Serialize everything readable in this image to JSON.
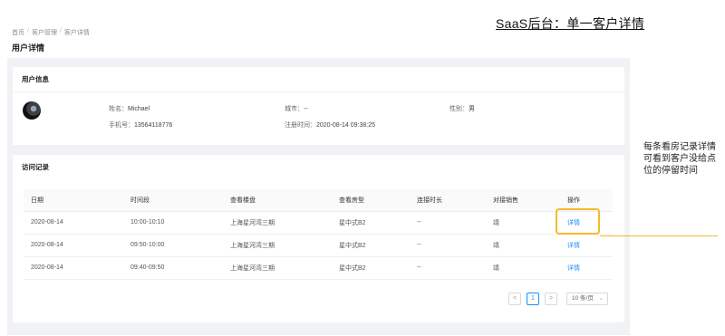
{
  "slide_title": "SaaS后台：单一客户详情",
  "breadcrumb": [
    "首页",
    "客户管理",
    "客户详情"
  ],
  "breadcrumb_sep": "/",
  "page_title": "用户详情",
  "user_card": {
    "title": "用户信息",
    "name_label": "姓名：",
    "name": "Michael",
    "phone_label": "手机号：",
    "phone": "13564118776",
    "city_label": "城市：",
    "city": "--",
    "register_label": "注册时间：",
    "register_time": "2020-08-14 09:38:25",
    "gender_label": "性别：",
    "gender": "男"
  },
  "visit_card": {
    "title": "访问记录",
    "columns": [
      "日期",
      "时间段",
      "查看楼盘",
      "查看房型",
      "连接时长",
      "对接销售",
      "操作"
    ],
    "rows": [
      [
        "2020-08-14",
        "10:00-10:10",
        "上海星河湾三期",
        "星中式B2",
        "--",
        "靖",
        "详情"
      ],
      [
        "2020-08-14",
        "09:50-10:00",
        "上海星河湾三期",
        "星中式B2",
        "--",
        "靖",
        "详情"
      ],
      [
        "2020-08-14",
        "09:40-09:50",
        "上海星河湾三期",
        "星中式B2",
        "--",
        "靖",
        "详情"
      ]
    ],
    "pager": {
      "prev": "<",
      "current": "1",
      "next": ">",
      "page_size": "10 条/页"
    }
  },
  "annotation": "每条看房记录详情可看到客户没给点位的停留时间",
  "colors": {
    "highlight": "#f5b82e",
    "link": "#1890ff",
    "background": "#f0f2f5"
  }
}
